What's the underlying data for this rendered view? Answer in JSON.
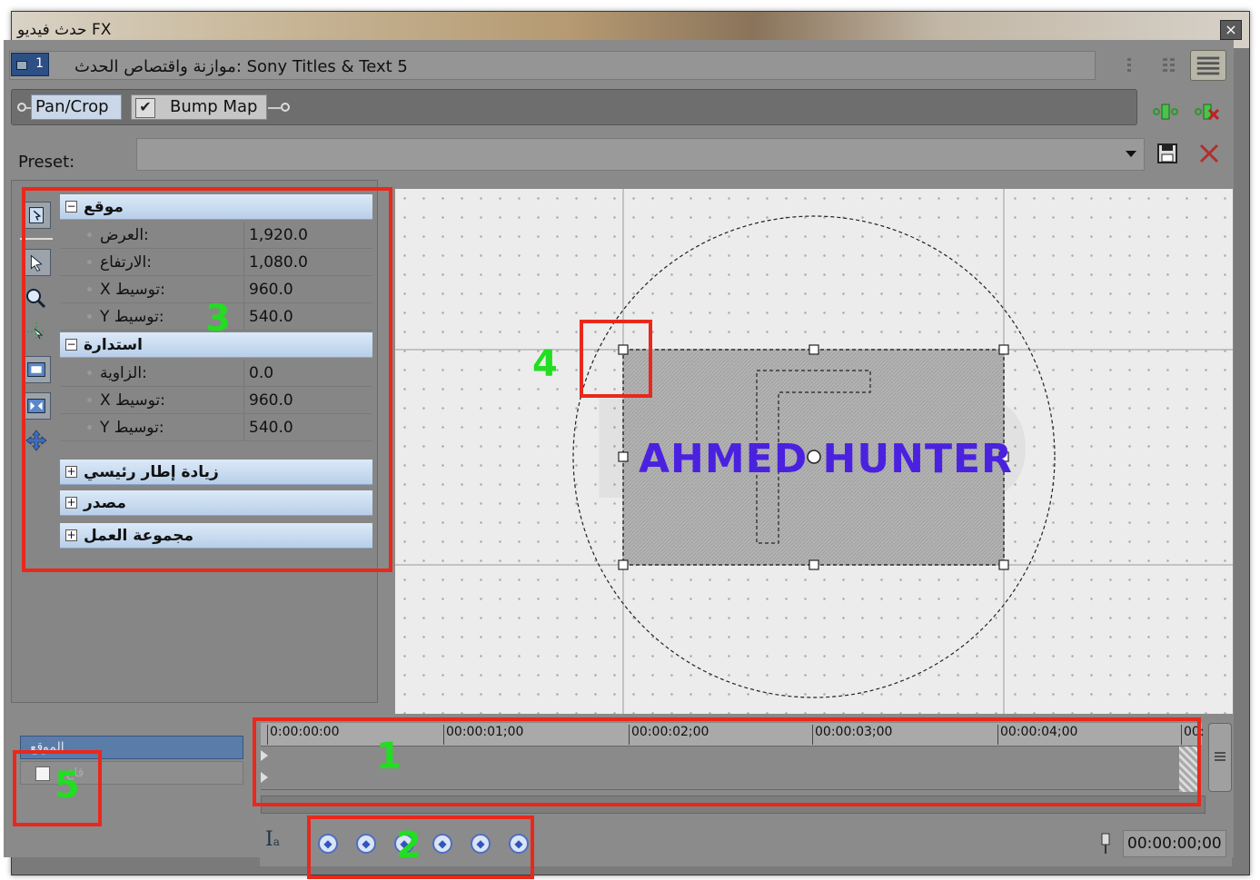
{
  "window": {
    "title": "حدث فيديو FX",
    "close_label": "×"
  },
  "header": {
    "badge_number": "1",
    "title_text": "موازنة واقتصاص الحدث: Sony Titles & Text 5"
  },
  "chain": {
    "pan_crop_label": "Pan/Crop",
    "bump_map_label": "Bump Map",
    "bump_map_checked": "✔"
  },
  "preset": {
    "label": "Preset:",
    "value": ""
  },
  "properties": {
    "groups": [
      {
        "label": "موقع",
        "sign": "−"
      },
      {
        "label": "استدارة",
        "sign": "−"
      },
      {
        "label": "زيادة إطار رئيسي",
        "sign": "+"
      },
      {
        "label": "مصدر",
        "sign": "+"
      },
      {
        "label": "مجموعة العمل",
        "sign": "+"
      }
    ],
    "position": [
      {
        "key": "العرض:",
        "value": "1,920.0"
      },
      {
        "key": "الارتفاع:",
        "value": "1,080.0"
      },
      {
        "key": "X توسيط:",
        "value": "960.0"
      },
      {
        "key": "Y توسيط:",
        "value": "540.0"
      }
    ],
    "rotation": [
      {
        "key": "الزاوية:",
        "value": "0.0"
      },
      {
        "key": "X توسيط:",
        "value": "960.0"
      },
      {
        "key": "Y توسيط:",
        "value": "540.0"
      }
    ]
  },
  "canvas": {
    "title_text": "AHMED HUNTER",
    "watermark": "LIVIO VERSION",
    "title_color": "#4b21e0"
  },
  "timeline": {
    "row_label": "الموقع",
    "row2_label": "قاع",
    "ticks": [
      "0:00:00:00",
      "00:00:01;00",
      "00:00:02;00",
      "00:00:03;00",
      "00:00:04;00",
      "00:"
    ],
    "current_time": "00:00:00;00"
  },
  "annotations": {
    "n1": "1",
    "n2": "2",
    "n3": "3",
    "n4": "4",
    "n5": "5",
    "color": "#e8281c"
  }
}
